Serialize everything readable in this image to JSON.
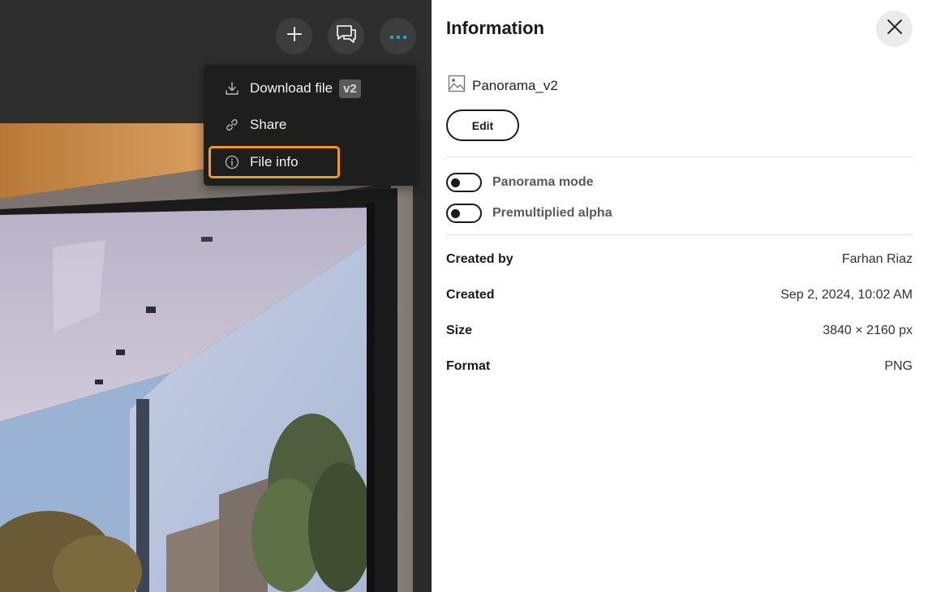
{
  "toolbar": {
    "add_icon": "plus-icon",
    "comments_icon": "comments-icon",
    "more_icon": "more-dots-icon",
    "accent_color": "#19a8e6"
  },
  "menu": {
    "download": {
      "label": "Download file",
      "badge": "v2",
      "icon": "download-icon"
    },
    "share": {
      "label": "Share",
      "icon": "link-icon"
    },
    "file_info": {
      "label": "File info",
      "icon": "info-icon",
      "highlight_color": "#f19a1f"
    }
  },
  "panel": {
    "title": "Information",
    "close_icon": "close-icon",
    "file_icon": "image-icon",
    "file_name": "Panorama_v2",
    "edit_label": "Edit",
    "toggles": [
      {
        "label": "Panorama mode",
        "on": false
      },
      {
        "label": "Premultiplied alpha",
        "on": false
      }
    ],
    "meta": [
      {
        "key": "Created by",
        "value": "Farhan Riaz"
      },
      {
        "key": "Created",
        "value": "Sep 2, 2024, 10:02 AM"
      },
      {
        "key": "Size",
        "value": "3840 × 2160 px"
      },
      {
        "key": "Format",
        "value": "PNG"
      }
    ]
  }
}
